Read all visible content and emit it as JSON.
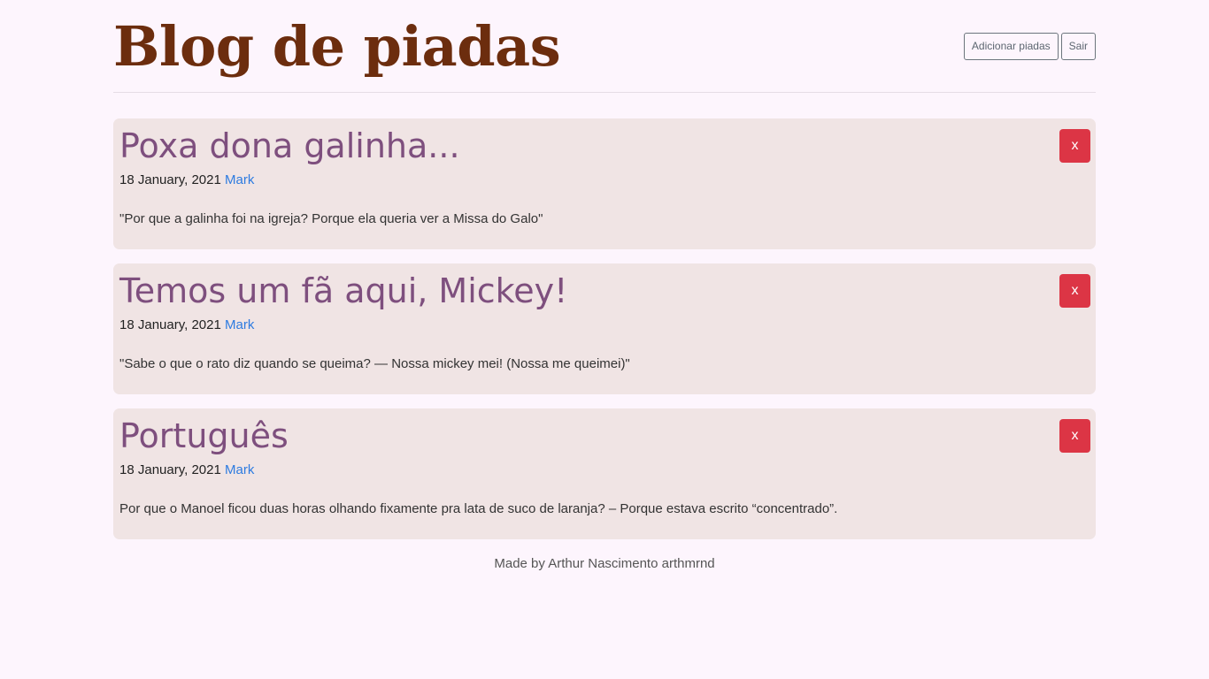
{
  "header": {
    "title": "Blog de piadas",
    "add_button": "Adicionar piadas",
    "logout_button": "Sair"
  },
  "posts": [
    {
      "title": "Poxa dona galinha...",
      "date": "18 January, 2021",
      "author": "Mark",
      "body": "\"Por que a galinha foi na igreja? Porque ela queria ver a Missa do Galo\"",
      "delete_label": "x"
    },
    {
      "title": "Temos um fã aqui, Mickey!",
      "date": "18 January, 2021",
      "author": "Mark",
      "body": "\"Sabe o que o rato diz quando se queima? — Nossa mickey mei! (Nossa me queimei)\"",
      "delete_label": "x"
    },
    {
      "title": "Português",
      "date": "18 January, 2021",
      "author": "Mark",
      "body": "Por que o Manoel ficou duas horas olhando fixamente pra lata de suco de laranja? – Porque estava escrito “concentrado”.",
      "delete_label": "x"
    }
  ],
  "footer": {
    "text": "Made by Arthur Nascimento arthmrnd"
  },
  "colors": {
    "background": "#fdf5fd",
    "title": "#6c2d0e",
    "post_background": "#f0e4e4",
    "post_title": "#7e4f7e",
    "author_link": "#2d7be0",
    "delete_button": "#dc3545"
  }
}
